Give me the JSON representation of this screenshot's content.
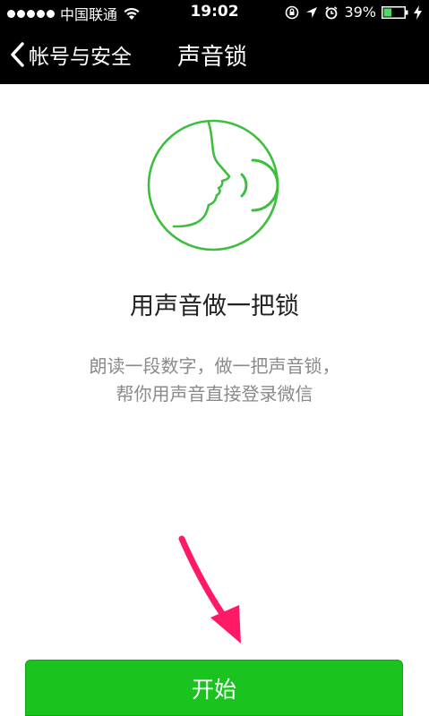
{
  "status_bar": {
    "carrier": "中国联通",
    "time": "19:02",
    "battery_percent": "39%",
    "battery_level": 0.39,
    "icons": [
      "signal-dots",
      "wifi-icon",
      "rotation-lock-icon",
      "location-icon",
      "alarm-icon",
      "battery-icon",
      "charging-icon"
    ]
  },
  "nav": {
    "back_label": "帐号与安全",
    "title": "声音锁"
  },
  "main": {
    "illustration_icon": "speaking-face-icon",
    "title": "用声音做一把锁",
    "description_line1": "朗读一段数字，做一把声音锁，",
    "description_line2": "帮你用声音直接登录微信"
  },
  "start_button": {
    "label": "开始"
  },
  "colors": {
    "header_bg": "#000000",
    "accent_green": "#1ac31f",
    "illustration_green": "#3dbf3d",
    "annotation_arrow": "#ff1a66",
    "description_gray": "#8a8a8a"
  }
}
